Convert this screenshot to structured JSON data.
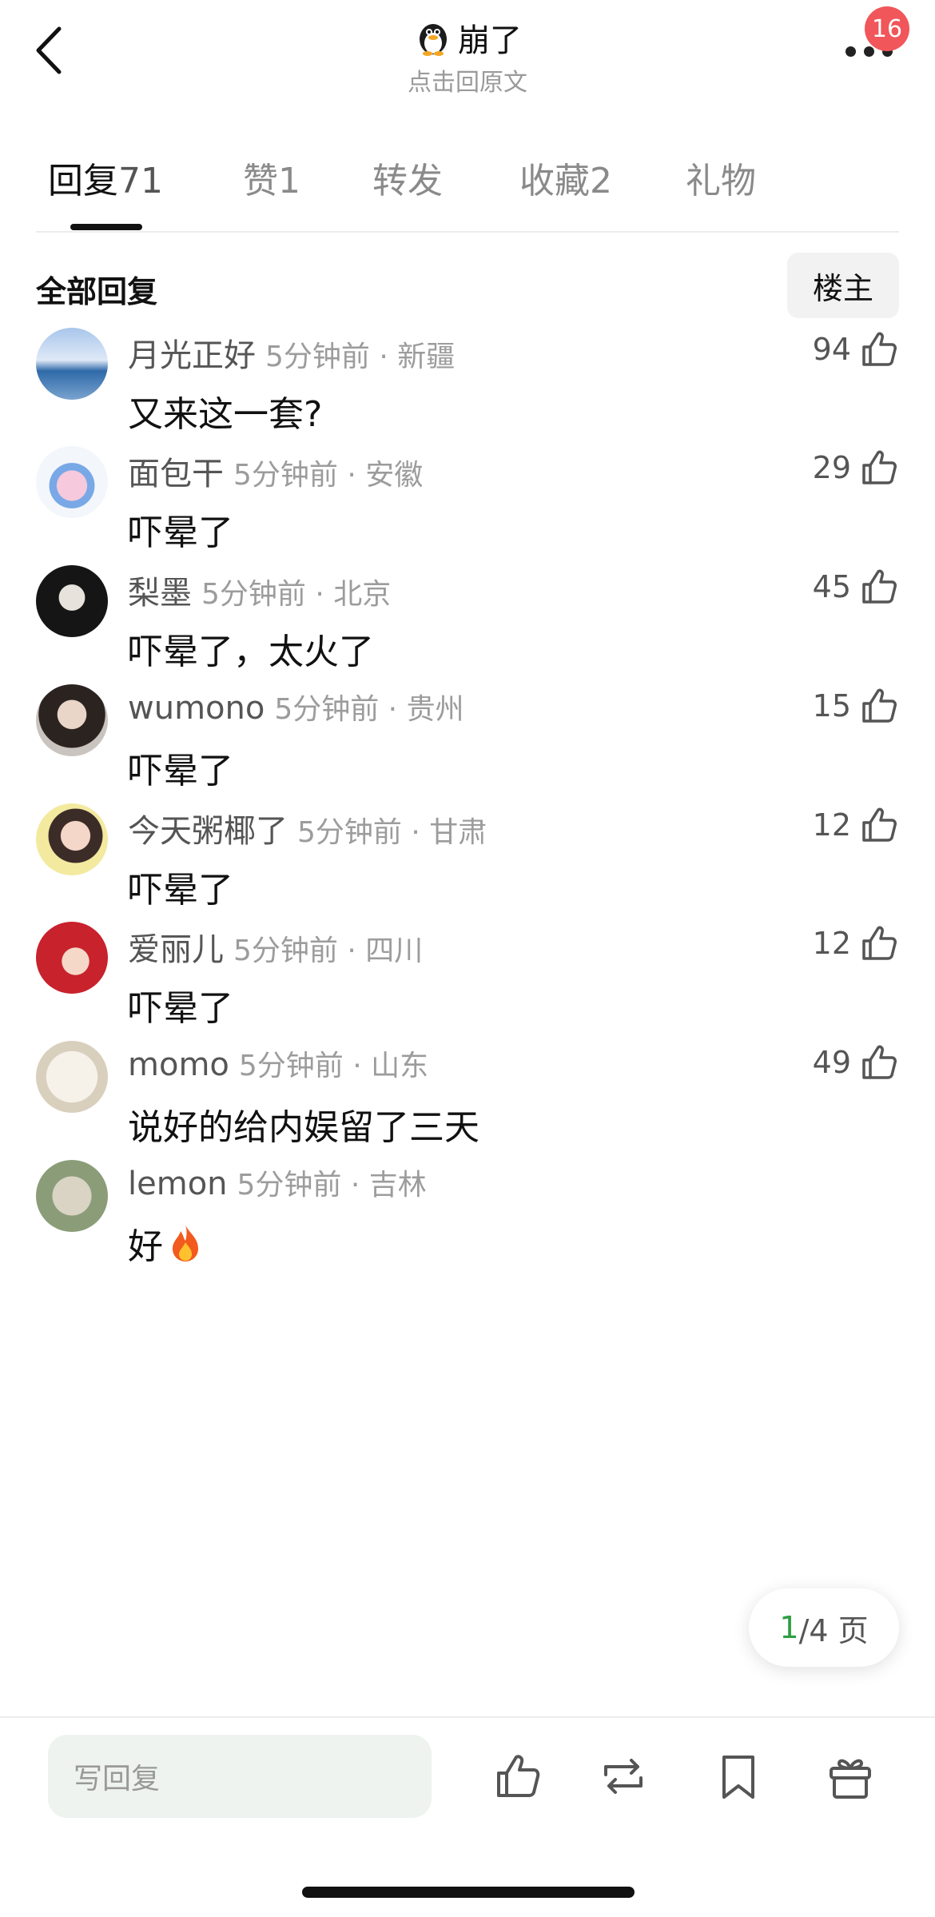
{
  "header": {
    "title": "崩了",
    "subtitle": "点击回原文",
    "badge_count": "16"
  },
  "tabs": [
    {
      "label": "回复",
      "count": "71",
      "active": true
    },
    {
      "label": "赞",
      "count": "1",
      "active": false
    },
    {
      "label": "转发",
      "count": "",
      "active": false
    },
    {
      "label": "收藏",
      "count": "2",
      "active": false
    },
    {
      "label": "礼物",
      "count": "",
      "active": false
    }
  ],
  "section": {
    "title": "全部回复",
    "op_button": "楼主"
  },
  "comments": [
    {
      "name": "月光正好",
      "time": "5分钟前 · 新疆",
      "text": "又来这一套?",
      "likes": "94"
    },
    {
      "name": "面包干",
      "time": "5分钟前 · 安徽",
      "text": "吓晕了",
      "likes": "29"
    },
    {
      "name": "梨墨",
      "time": "5分钟前 · 北京",
      "text": "吓晕了，太火了",
      "likes": "45"
    },
    {
      "name": "wumono",
      "time": "5分钟前 · 贵州",
      "text": "吓晕了",
      "likes": "15"
    },
    {
      "name": "今天粥椰了",
      "time": "5分钟前 · 甘肃",
      "text": "吓晕了",
      "likes": "12"
    },
    {
      "name": "爱丽儿",
      "time": "5分钟前 · 四川",
      "text": "吓晕了",
      "likes": "12"
    },
    {
      "name": "momo",
      "time": "5分钟前 · 山东",
      "text": "说好的给内娱留了三天",
      "likes": "49"
    },
    {
      "name": "lemon",
      "time": "5分钟前 · 吉林",
      "text": "好",
      "likes": ""
    }
  ],
  "pagination": {
    "current": "1",
    "rest": "/4 页"
  },
  "bottom_bar": {
    "reply_placeholder": "写回复"
  },
  "colors": {
    "badge": "#f0565a",
    "page_current": "#2e9e43",
    "input_bg": "#eef3ef"
  },
  "icons": [
    "back-arrow-icon",
    "penguin-icon",
    "more-icon",
    "thumbs-up-icon",
    "fire-icon",
    "repost-icon",
    "bookmark-icon",
    "gift-icon"
  ]
}
